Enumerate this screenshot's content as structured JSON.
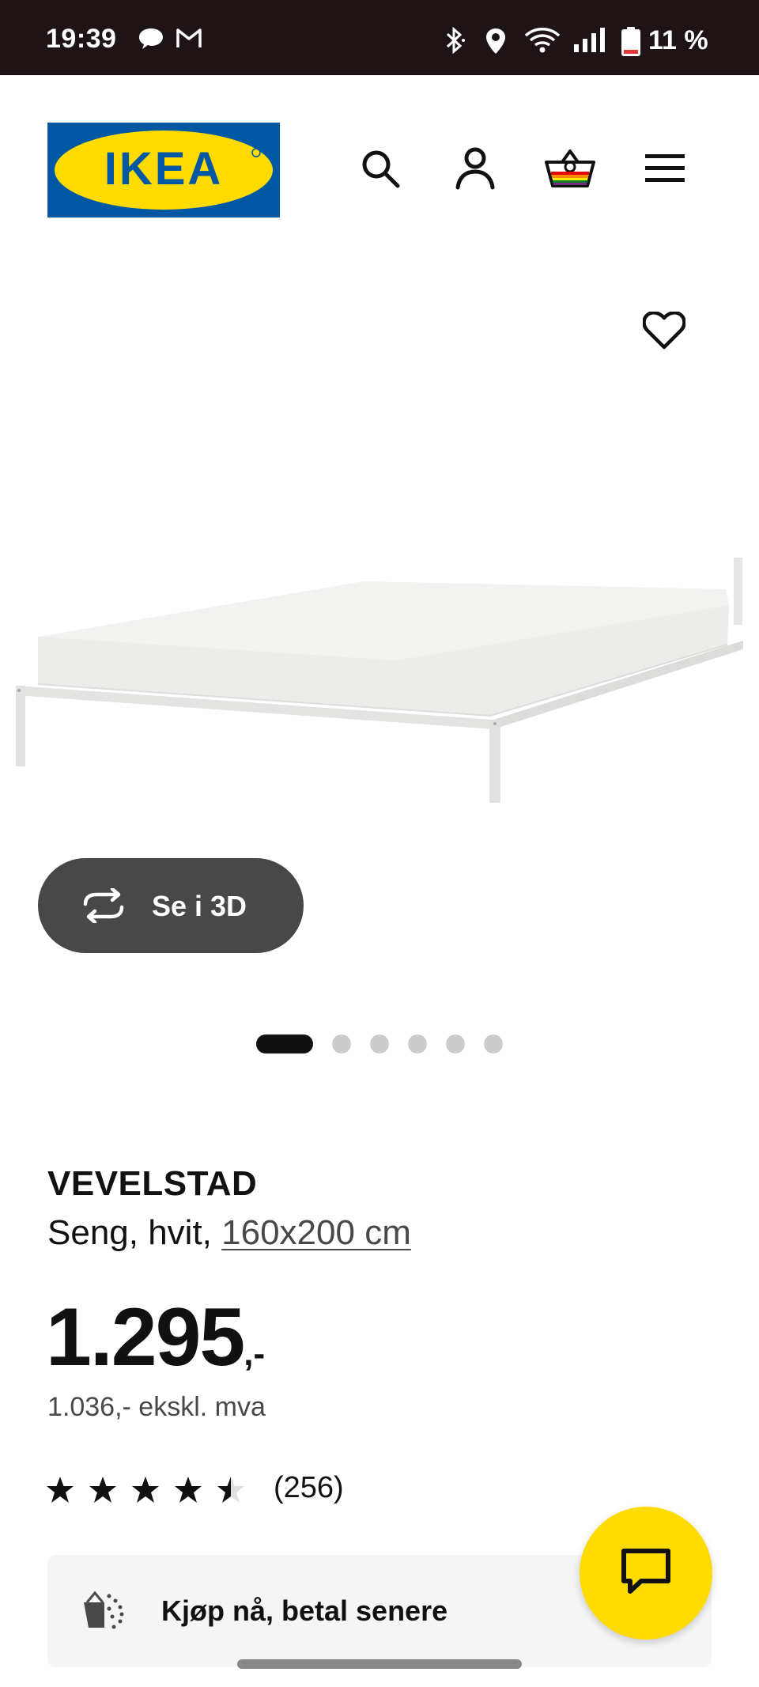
{
  "status_bar": {
    "time": "19:39",
    "battery": "11 %",
    "icons": [
      "chat-bubble-icon",
      "gmail-icon",
      "bluetooth-icon",
      "location-icon",
      "wifi-icon",
      "signal-icon",
      "battery-icon"
    ]
  },
  "header": {
    "logo_text": "IKEA",
    "icons": [
      "search-icon",
      "account-icon",
      "shopping-bag-icon",
      "menu-icon"
    ]
  },
  "gallery": {
    "view_3d_label": "Se i 3D",
    "image_count": 6,
    "active_index": 0
  },
  "product": {
    "name": "VEVELSTAD",
    "description": "Seng, hvit,",
    "size": "160x200 cm",
    "price": "1.295",
    "price_suffix": ",-",
    "price_ex_vat": "1.036,- ekskl. mva",
    "rating_value": 4.5,
    "rating_max": 5,
    "rating_count": "(256)"
  },
  "pay_later": {
    "label": "Kjøp nå, betal senere"
  },
  "colors": {
    "ikea_blue": "#0058a3",
    "ikea_yellow": "#ffdb00",
    "status_bar": "#1e1416",
    "button_dark": "#484848"
  }
}
